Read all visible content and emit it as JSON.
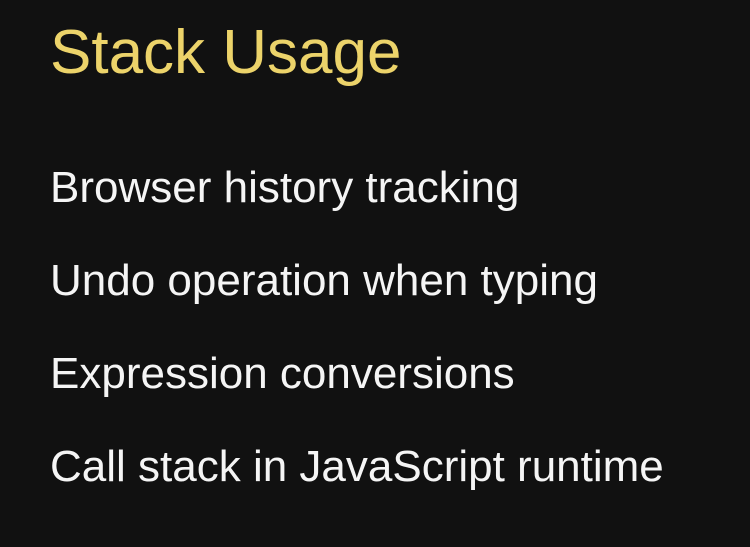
{
  "slide": {
    "title": "Stack Usage",
    "items": [
      "Browser history tracking",
      "Undo operation when typing",
      "Expression conversions",
      "Call stack in JavaScript runtime"
    ]
  },
  "colors": {
    "background": "#111111",
    "title": "#ecd36a",
    "text": "#f5f5f5"
  }
}
